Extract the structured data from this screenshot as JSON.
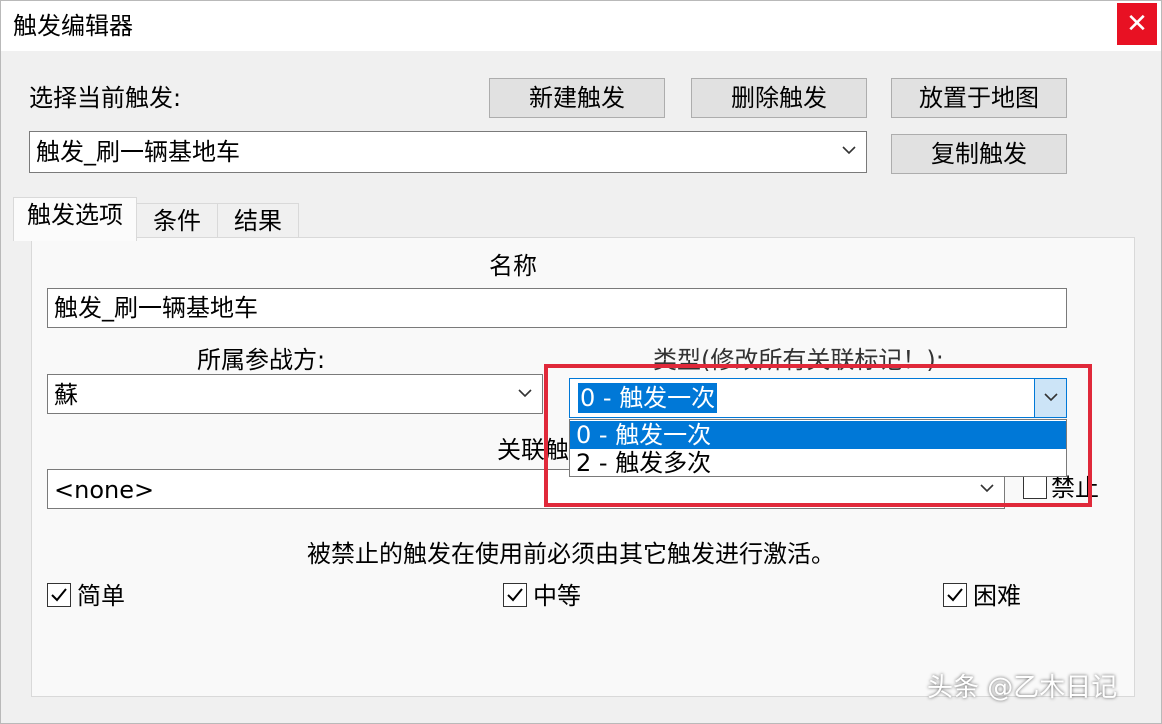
{
  "window": {
    "title": "触发编辑器",
    "close_glyph": "✕"
  },
  "top": {
    "select_label": "选择当前触发:",
    "current_trigger": "触发_刷一辆基地车",
    "buttons": {
      "new": "新建触发",
      "delete": "删除触发",
      "place_on_map": "放置于地图",
      "copy": "复制触发"
    }
  },
  "tabs": [
    {
      "label": "触发选项",
      "active": true
    },
    {
      "label": "条件",
      "active": false
    },
    {
      "label": "结果",
      "active": false
    }
  ],
  "options": {
    "name_label": "名称",
    "name_value": "触发_刷一辆基地车",
    "side_label": "所属参战方:",
    "side_value": "蘇",
    "type_label": "类型(修改所有关联标记！):",
    "type_value": "0 - 触发一次",
    "type_options": [
      "0 - 触发一次",
      "2 - 触发多次"
    ],
    "linked_label": "关联触",
    "linked_value": "<none>",
    "disable_label": "禁止",
    "disable_checked": false,
    "note": "被禁止的触发在使用前必须由其它触发进行激活。",
    "difficulty": [
      {
        "label": "简单",
        "checked": true
      },
      {
        "label": "中等",
        "checked": true
      },
      {
        "label": "困难",
        "checked": true
      }
    ]
  },
  "watermark": "头条 @乙木日记",
  "colors": {
    "selection": "#0078d7",
    "close": "#e81123",
    "highlight": "#e0293a"
  }
}
